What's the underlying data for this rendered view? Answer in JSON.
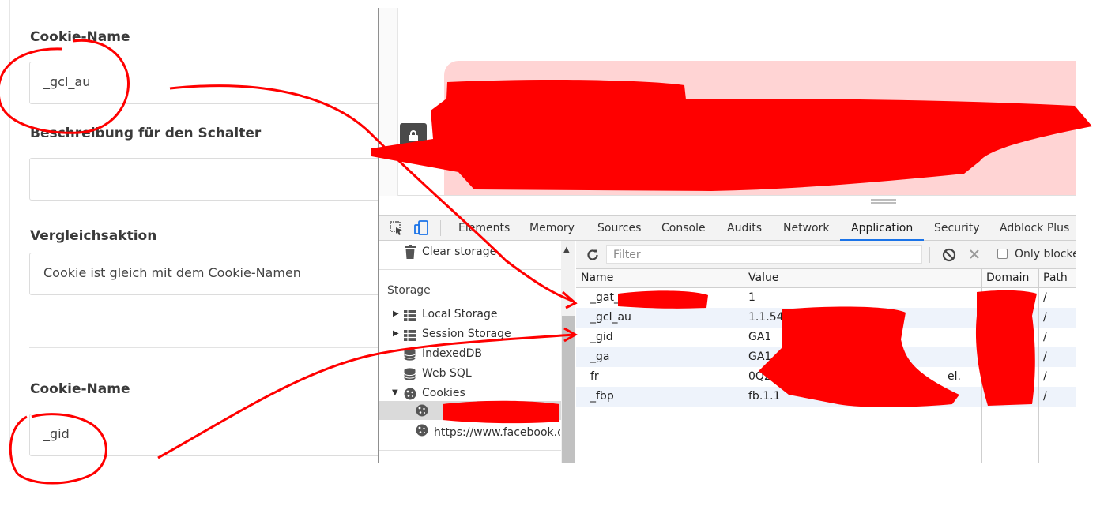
{
  "form": {
    "label1": "Cookie-Name",
    "value1": "_gcl_au",
    "label2": "Beschreibung für den Schalter",
    "value2": "",
    "label3": "Vergleichsaktion",
    "value3": "Cookie ist gleich mit dem Cookie-Namen",
    "label4": "Cookie-Name",
    "value4": "_gid"
  },
  "devtools": {
    "tabs": [
      "Elements",
      "Memory",
      "Sources",
      "Console",
      "Audits",
      "Network",
      "Application",
      "Security",
      "Adblock Plus"
    ],
    "active_tab": "Application",
    "sidebar": {
      "clear_storage": "Clear storage",
      "storage_heading": "Storage",
      "local_storage": "Local Storage",
      "session_storage": "Session Storage",
      "indexeddb": "IndexedDB",
      "web_sql": "Web SQL",
      "cookies": "Cookies",
      "facebook_origin": "https://www.facebook.co"
    },
    "filter_placeholder": "Filter",
    "only_blocked_label": "Only blocke",
    "columns": [
      "Name",
      "Value",
      "Domain",
      "Path"
    ],
    "rows": [
      {
        "name": "_gat_",
        "value": "1",
        "domain": "",
        "path": "/"
      },
      {
        "name": "_gcl_au",
        "value": "1.1.54",
        "domain": "",
        "path": "/"
      },
      {
        "name": "_gid",
        "value": "GA1",
        "domain": "",
        "path": "/"
      },
      {
        "name": "_ga",
        "value": "GA1",
        "domain": "",
        "path": "/"
      },
      {
        "name": "fr",
        "value": "0Q2i",
        "domain": "",
        "path": "/"
      },
      {
        "name": "_fbp",
        "value": "fb.1.1",
        "domain": "",
        "path": "/"
      }
    ],
    "row_value_tail": "el."
  },
  "colors": {
    "accent": "#1a73e8",
    "annotation": "#ff0000",
    "banner": "#ffd4d4",
    "row_alt": "#eef3fb"
  },
  "icons": [
    "lock-icon",
    "inspect-icon",
    "device-toolbar-icon",
    "trash-icon",
    "refresh-icon",
    "block-icon",
    "clear-icon",
    "grid-icon",
    "database-icon",
    "cookie-icon",
    "triangle-right-icon",
    "triangle-down-icon"
  ]
}
